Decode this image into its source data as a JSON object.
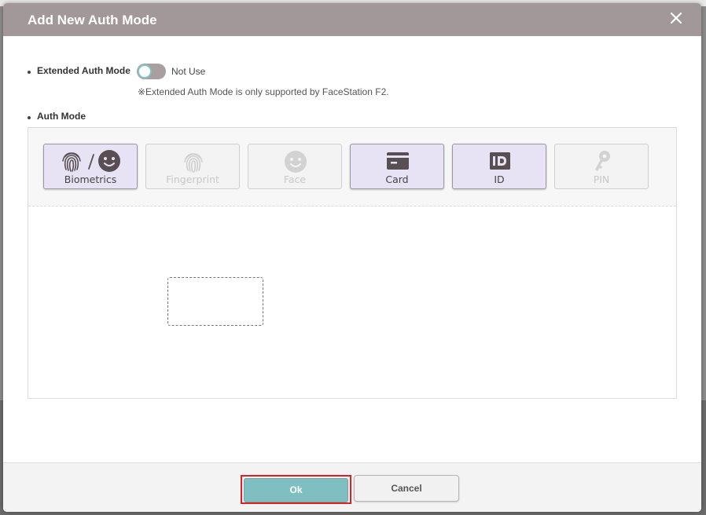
{
  "dialog": {
    "title": "Add New Auth Mode"
  },
  "extended_auth": {
    "label": "Extended Auth Mode",
    "toggle_state": "Not Use",
    "note": "※Extended Auth Mode is only supported by FaceStation F2."
  },
  "auth_mode": {
    "label": "Auth Mode",
    "modes": [
      {
        "label": "Biometrics",
        "active": true,
        "icon": "biometrics-icon"
      },
      {
        "label": "Fingerprint",
        "active": false,
        "icon": "fingerprint-icon"
      },
      {
        "label": "Face",
        "active": false,
        "icon": "face-icon"
      },
      {
        "label": "Card",
        "active": true,
        "icon": "card-icon"
      },
      {
        "label": "ID",
        "active": true,
        "icon": "id-icon"
      },
      {
        "label": "PIN",
        "active": false,
        "icon": "key-icon"
      }
    ]
  },
  "footer": {
    "ok_label": "Ok",
    "cancel_label": "Cancel"
  },
  "colors": {
    "header_bg": "#a29799",
    "ok_bg": "#7fbfc2",
    "highlight_border": "#e02020",
    "active_mode_bg": "#e8e2f5"
  }
}
